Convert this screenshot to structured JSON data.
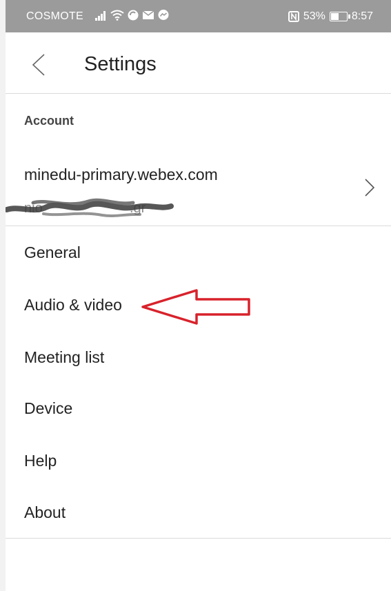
{
  "status_bar": {
    "carrier": "COSMOTE",
    "battery": "53%",
    "battery_level": 0.53,
    "time": "8:57",
    "icons": [
      "signal-icon",
      "wifi-icon",
      "sync-icon",
      "mail-icon",
      "messenger-icon",
      "nfc-icon",
      "battery-icon"
    ]
  },
  "header": {
    "title": "Settings",
    "back_icon": "chevron-left-icon"
  },
  "account_section": {
    "label": "Account",
    "server": "minedu-primary.webex.com",
    "email_visible": "nio.gr",
    "chevron_icon": "chevron-right-icon"
  },
  "menu": [
    {
      "label": "General"
    },
    {
      "label": "Audio & video"
    },
    {
      "label": "Meeting list"
    },
    {
      "label": "Device"
    },
    {
      "label": "Help"
    },
    {
      "label": "About"
    }
  ],
  "colors": {
    "status_bar": "#9b9b9b",
    "annotation_arrow": "#d8222b",
    "divider": "#dadada"
  }
}
